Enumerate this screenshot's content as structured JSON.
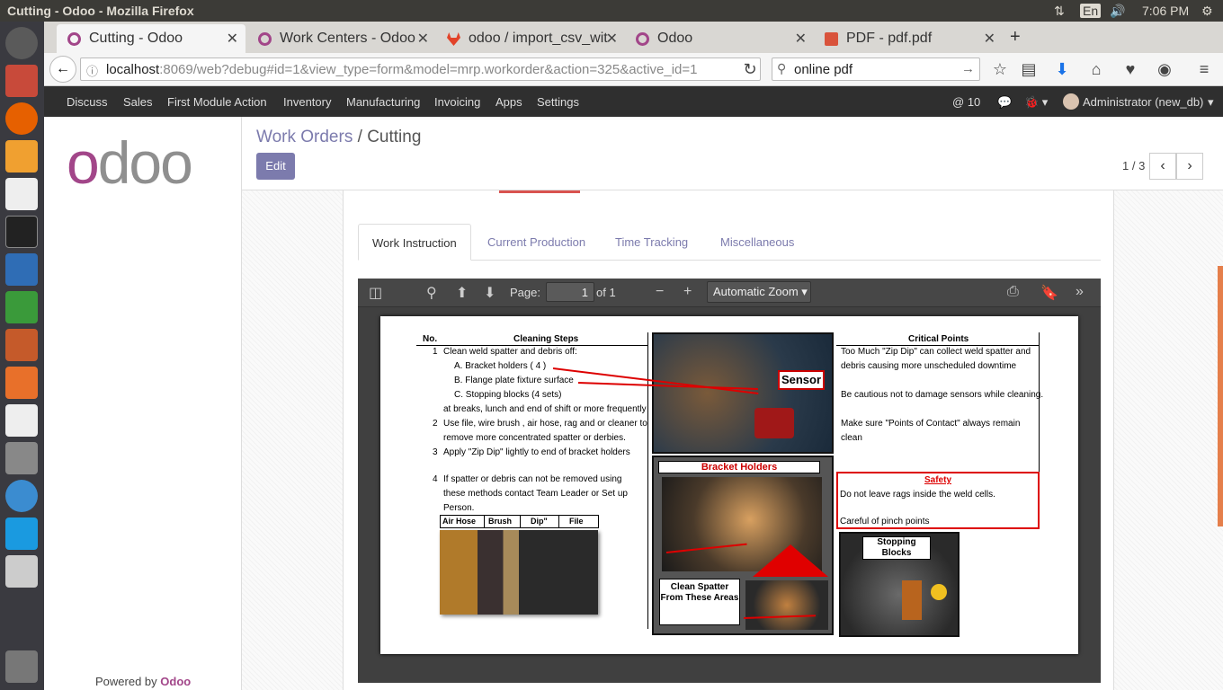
{
  "os": {
    "window_title": "Cutting - Odoo - Mozilla Firefox",
    "clock": "7:06 PM",
    "keyboard": "En"
  },
  "browser": {
    "tabs": [
      {
        "label": "Cutting - Odoo"
      },
      {
        "label": "Work Centers - Odoo"
      },
      {
        "label": "odoo / import_csv_wit"
      },
      {
        "label": "Odoo"
      },
      {
        "label": "PDF - pdf.pdf"
      }
    ],
    "url_host": "localhost",
    "url_rest": ":8069/web?debug#id=1&view_type=form&model=mrp.workorder&action=325&active_id=1",
    "search_value": "online pdf"
  },
  "odoo": {
    "menu": [
      "Discuss",
      "Sales",
      "First Module Action",
      "Inventory",
      "Manufacturing",
      "Invoicing",
      "Apps",
      "Settings"
    ],
    "notifications": "10",
    "user": "Administrator (new_db)",
    "logo_text": "odoo",
    "powered_by": "Powered by",
    "powered_brand": "Odoo",
    "breadcrumb_parent": "Work Orders",
    "breadcrumb_sep": "/",
    "breadcrumb_current": "Cutting",
    "edit_label": "Edit",
    "pager": "1 / 3",
    "form_tabs": [
      "Work Instruction",
      "Current Production",
      "Time Tracking",
      "Miscellaneous"
    ]
  },
  "pdf_viewer": {
    "page_label": "Page:",
    "page_value": "1",
    "page_of": "of 1",
    "zoom": "Automatic Zoom"
  },
  "document": {
    "col_no": "No.",
    "col_steps": "Cleaning Steps",
    "col_critical": "Critical Points",
    "steps": [
      {
        "no": "1",
        "text": "Clean weld spatter and debris off:"
      },
      {
        "no": "",
        "text": "A. Bracket holders ( 4 )"
      },
      {
        "no": "",
        "text": "B. Flange plate fixture surface"
      },
      {
        "no": "",
        "text": "C. Stopping blocks (4 sets)"
      },
      {
        "no": "",
        "text": "at breaks, lunch and end of shift or more frequently"
      },
      {
        "no": "2",
        "text": "Use file, wire brush , air hose, rag and or cleaner to"
      },
      {
        "no": "",
        "text": "remove more concentrated spatter or derbies."
      },
      {
        "no": "3",
        "text": "Apply \"Zip Dip\" lightly to end of bracket holders"
      },
      {
        "no": "",
        "text": ""
      },
      {
        "no": "4",
        "text": "If spatter or debris can not be removed using"
      },
      {
        "no": "",
        "text": "these methods contact Team Leader or Set up"
      },
      {
        "no": "",
        "text": "Person."
      }
    ],
    "tools": [
      "Air Hose",
      "Brush",
      "Dip\"",
      "File"
    ],
    "critical": [
      "Too Much \"Zip Dip\" can collect weld spatter and",
      "debris causing more unscheduled downtime",
      "",
      "Be cautious not to damage sensors while cleaning.",
      "",
      "Make sure \"Points of Contact\" always remain",
      "clean"
    ],
    "safety_title": "Safety",
    "safety_lines": [
      "Do not leave rags inside the weld cells.",
      "",
      "Careful of pinch points"
    ],
    "sensor_label": "Sensor",
    "bracket_label": "Bracket Holders",
    "clean_label": "Clean Spatter From These Areas",
    "stopping_label": "Stopping Blocks"
  }
}
